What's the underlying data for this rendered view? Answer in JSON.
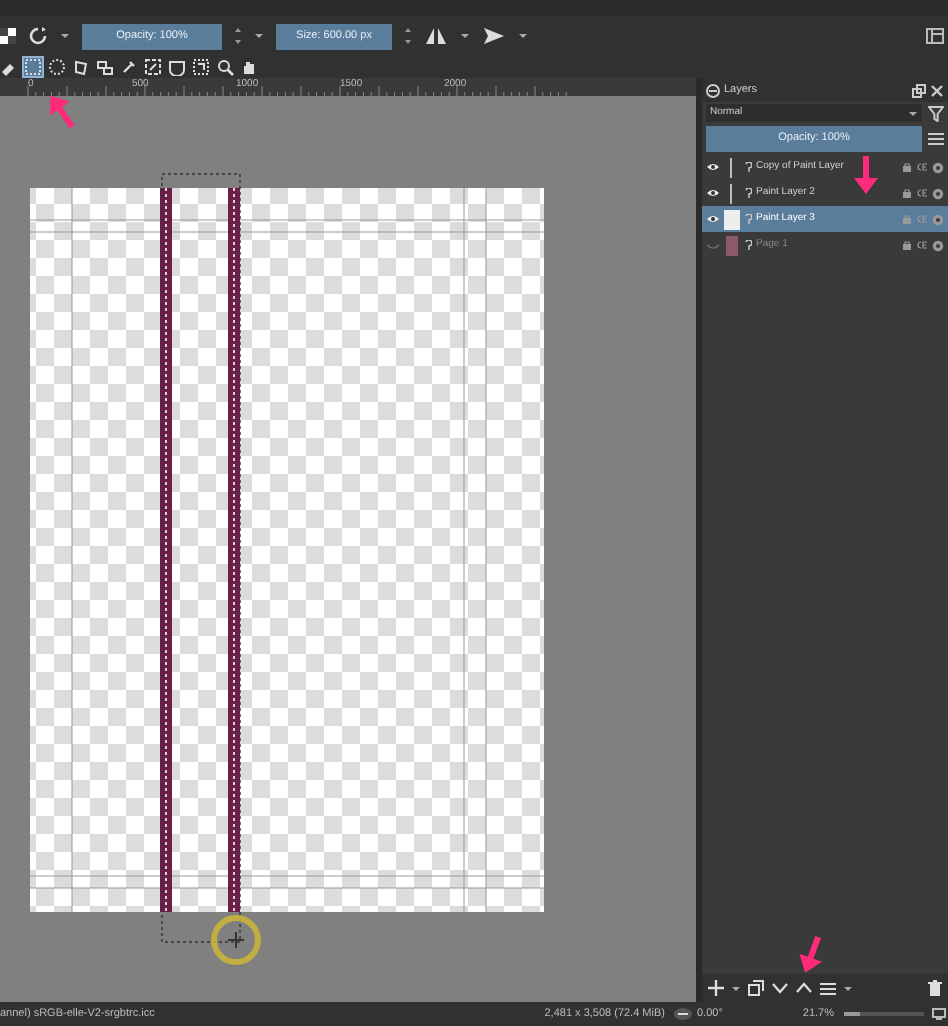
{
  "toolbar": {
    "opacity": {
      "label": "Opacity: 100%",
      "level": 1
    },
    "size": {
      "label": "Size: 600.00 px",
      "level": 1
    }
  },
  "tools": [
    {
      "selected": false
    },
    {
      "selected": true
    },
    {
      "selected": false
    },
    {
      "selected": false
    },
    {
      "selected": false
    },
    {
      "selected": false
    },
    {
      "selected": false
    },
    {
      "selected": false
    },
    {
      "selected": false
    },
    {
      "selected": false
    },
    {
      "selected": false
    }
  ],
  "ruler": {
    "ticks": [
      "0",
      "500",
      "1000",
      "1500",
      "2000"
    ]
  },
  "layers_panel": {
    "title": "Layers",
    "blend_mode": "Normal",
    "opacity": {
      "label": "Opacity:  100%",
      "level": 1
    },
    "layers": [
      {
        "name": "Copy of Paint Layer",
        "visible": true,
        "selected": false,
        "kind": "paint"
      },
      {
        "name": "Paint Layer 2",
        "visible": true,
        "selected": false,
        "kind": "paint"
      },
      {
        "name": "Paint Layer 3",
        "visible": true,
        "selected": true,
        "kind": "paint"
      },
      {
        "name": "Page 1",
        "visible": false,
        "selected": false,
        "kind": "image"
      }
    ]
  },
  "status_bar": {
    "profile": "annel)  sRGB-elle-V2-srgbtrc.icc",
    "dimensions": "2,481 x 3,508 (72.4 MiB)",
    "rotation": "0.00°",
    "zoom": "21.7%",
    "zoom_slider": {
      "level": 0.2
    }
  }
}
